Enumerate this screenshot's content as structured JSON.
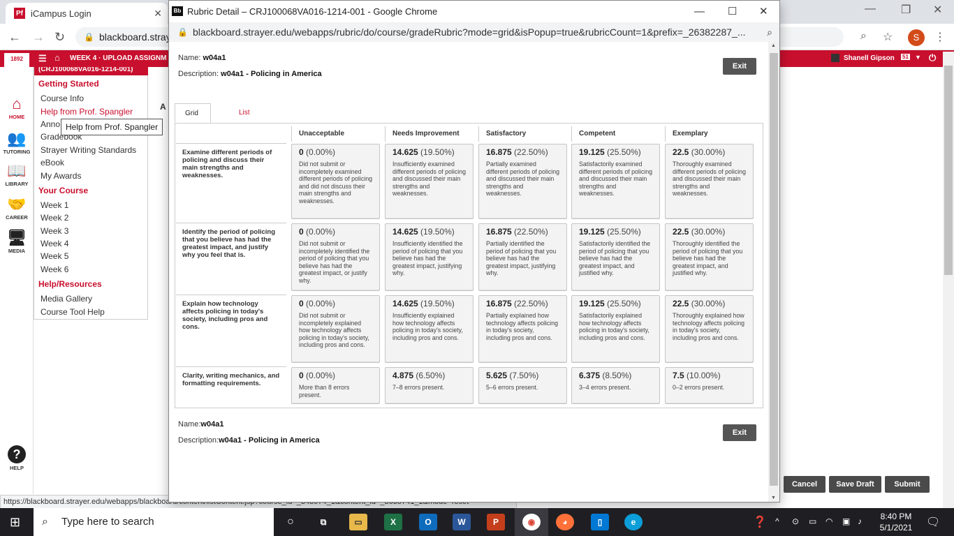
{
  "background_browser": {
    "tab_title": "iCampus Login",
    "tab_favicon": "Pf",
    "url": "blackboard.stray",
    "profile_initial": "S"
  },
  "blackboard": {
    "breadcrumb": "WEEK 4 · UPLOAD ASSIGNM",
    "user_name": "Shanell Gipson",
    "notif_count": "51",
    "logo_year": "1892",
    "course_id": "(CRJ100068VA016-1214-001)",
    "left_nav": [
      "HOME",
      "TUTORING",
      "LIBRARY",
      "CAREER",
      "MEDIA",
      "HELP"
    ],
    "menu_sections": {
      "getting_started": "Getting Started",
      "your_course": "Your Course",
      "help_resources": "Help/Resources"
    },
    "menu_links_getting_started": [
      "Course Info",
      "Help from Prof. Spangler",
      "Anno",
      "Gradebook",
      "Strayer Writing Standards",
      "eBook",
      "My Awards"
    ],
    "menu_links_course": [
      "Week 1",
      "Week 2",
      "Week 3",
      "Week 4",
      "Week 5",
      "Week 6"
    ],
    "menu_links_help": [
      "Media Gallery",
      "Course Tool Help"
    ],
    "tooltip": "Help from Prof. Spangler",
    "partial_letter": "A",
    "buttons": {
      "cancel": "Cancel",
      "save_draft": "Save Draft",
      "submit": "Submit"
    },
    "status_url": "https://blackboard.strayer.edu/webapps/blackboard/content/listContent.jsp?course_id=_343974_1&content_id=_3635741_1&mode=reset"
  },
  "popup": {
    "window_title": "Rubric Detail – CRJ100068VA016-1214-001 - Google Chrome",
    "favicon": "Bb",
    "url": "blackboard.strayer.edu/webapps/rubric/do/course/gradeRubric?mode=grid&isPopup=true&rubricCount=1&prefix=_26382287_...",
    "name_label": "Name:",
    "name_value": "w04a1",
    "description_label": "Description:",
    "description_value": "w04a1 - Policing in America",
    "exit_label": "Exit",
    "tabs": {
      "grid": "Grid View",
      "list": "List View"
    },
    "levels": [
      "Unacceptable",
      "Needs Improvement",
      "Satisfactory",
      "Competent",
      "Exemplary"
    ],
    "criteria": [
      {
        "name": "Examine different periods of policing and discuss their main strengths and weaknesses.",
        "cells": [
          {
            "points": "0",
            "pct": "(0.00%)",
            "desc": "Did not submit or incompletely examined different periods of policing and did not discuss their main strengths and weaknesses."
          },
          {
            "points": "14.625",
            "pct": "(19.50%)",
            "desc": "Insufficiently examined different periods of policing and discussed their main strengths and weaknesses."
          },
          {
            "points": "16.875",
            "pct": "(22.50%)",
            "desc": "Partially examined different periods of policing and discussed their main strengths and weaknesses."
          },
          {
            "points": "19.125",
            "pct": "(25.50%)",
            "desc": "Satisfactorily examined different periods of policing and discussed their main strengths and weaknesses."
          },
          {
            "points": "22.5",
            "pct": "(30.00%)",
            "desc": "Thoroughly examined different periods of policing and discussed their main strengths and weaknesses."
          }
        ]
      },
      {
        "name": "Identify the period of policing that you believe has had the greatest impact, and justify why you feel that is.",
        "cells": [
          {
            "points": "0",
            "pct": "(0.00%)",
            "desc": "Did not submit or incompletely identified the period of policing that you believe has had the greatest impact, or justify why."
          },
          {
            "points": "14.625",
            "pct": "(19.50%)",
            "desc": "Insufficiently identified the period of policing that you believe has had the greatest impact, justifying why."
          },
          {
            "points": "16.875",
            "pct": "(22.50%)",
            "desc": "Partially identified the period of policing that you believe has had the greatest impact, justifying why."
          },
          {
            "points": "19.125",
            "pct": "(25.50%)",
            "desc": "Satisfactorily identified the period of policing that you believe has had the greatest impact, and justified why."
          },
          {
            "points": "22.5",
            "pct": "(30.00%)",
            "desc": "Thoroughly identified the period of policing that you believe has had the greatest impact, and justified why."
          }
        ]
      },
      {
        "name": "Explain how technology affects policing in today's society, including pros and cons.",
        "cells": [
          {
            "points": "0",
            "pct": "(0.00%)",
            "desc": "Did not submit or incompletely explained how technology affects policing in today's society, including pros and cons."
          },
          {
            "points": "14.625",
            "pct": "(19.50%)",
            "desc": "Insufficiently explained how technology affects policing in today's society, including pros and cons."
          },
          {
            "points": "16.875",
            "pct": "(22.50%)",
            "desc": "Partially explained how technology affects policing in today's society, including pros and cons."
          },
          {
            "points": "19.125",
            "pct": "(25.50%)",
            "desc": "Satisfactorily explained how technology affects policing in today's society, including pros and cons."
          },
          {
            "points": "22.5",
            "pct": "(30.00%)",
            "desc": "Thoroughly explained how technology affects policing in today's society, including pros and cons."
          }
        ]
      },
      {
        "name": "Clarity, writing mechanics, and formatting requirements.",
        "cells": [
          {
            "points": "0",
            "pct": "(0.00%)",
            "desc": "More than 8 errors present."
          },
          {
            "points": "4.875",
            "pct": "(6.50%)",
            "desc": "7–8 errors present."
          },
          {
            "points": "5.625",
            "pct": "(7.50%)",
            "desc": "5–6 errors present."
          },
          {
            "points": "6.375",
            "pct": "(8.50%)",
            "desc": "3–4 errors present."
          },
          {
            "points": "7.5",
            "pct": "(10.00%)",
            "desc": "0–2 errors present."
          }
        ]
      }
    ]
  },
  "taskbar": {
    "search_placeholder": "Type here to search",
    "time": "8:40 PM",
    "date": "5/1/2021"
  },
  "colors": {
    "brand_red": "#c8102e",
    "button_gray": "#555555",
    "taskbar": "#1f1f23"
  }
}
